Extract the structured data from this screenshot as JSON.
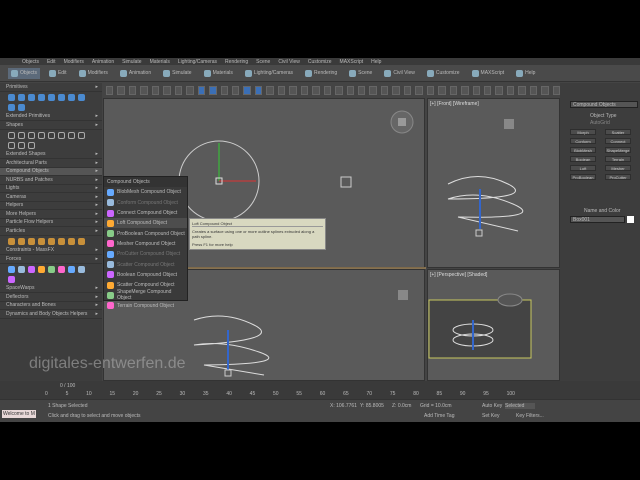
{
  "menu": [
    "Objects",
    "Edit",
    "Modifiers",
    "Animation",
    "Simulate",
    "Materials",
    "Lighting/Cameras",
    "Rendering",
    "Scene",
    "Civil View",
    "Customize",
    "MAXScript",
    "Help"
  ],
  "ribbon": [
    "Objects",
    "Edit",
    "Modifiers",
    "Animation",
    "Simulate",
    "Materials",
    "Lighting/Cameras",
    "Rendering",
    "Scene",
    "Civil View",
    "Customize",
    "MAXScript",
    "Help"
  ],
  "left_sections": [
    "Primitives",
    "Extended Primitives",
    "Shapes",
    "Extended Shapes",
    "Architectural Parts",
    "Compound Objects",
    "NURBS and Patches",
    "Lights",
    "Cameras",
    "Helpers",
    "More Helpers",
    "Particle Flow Helpers",
    "Particles",
    "Constraints - MassFX",
    "Forces",
    "SpaceWarps",
    "Deflectors",
    "Characters and Bones",
    "Dynamics and Body Objects Helpers"
  ],
  "popup": {
    "title": "Compound Objects",
    "items": [
      "BlobMesh Compound Object",
      "Conform Compound Object",
      "Connect Compound Object",
      "Loft Compound Object",
      "ProBoolean Compound Object",
      "Mesher Compound Object",
      "ProCutter Compound Object",
      "Scatter Compound Object",
      "Boolean Compound Object",
      "Scatter Compound Object",
      "ShapeMerge Compound Object",
      "Terrain Compound Object"
    ]
  },
  "tooltip": {
    "title": "Loft Compound Object",
    "desc": "Creates a surface using one or more outline splines extruded along a path spline.",
    "help": "Press F1 for more help"
  },
  "viewports": {
    "front": "[+] [Front] [Wireframe]",
    "persp": "[+] [Perspective] [Shaded]"
  },
  "right": {
    "dropdown": "Compound Objects",
    "rollout": "Object Type",
    "auto_grid": "AutoGrid",
    "buttons": [
      "Morph",
      "Scatter",
      "Conform",
      "Connect",
      "BlobMesh",
      "ShapeMerge",
      "Boolean",
      "Terrain",
      "Loft",
      "Mesher",
      "ProBoolean",
      "ProCutter"
    ],
    "name_rollout": "Name and Color",
    "name_value": "Box001"
  },
  "timeline": {
    "frame": "0 / 100",
    "ticks": [
      "0",
      "5",
      "10",
      "15",
      "20",
      "25",
      "30",
      "35",
      "40",
      "45",
      "50",
      "55",
      "60",
      "65",
      "70",
      "75",
      "80",
      "85",
      "90",
      "95",
      "100"
    ]
  },
  "status": {
    "selected": "1 Shape Selected",
    "prompt": "Click and drag to select and move objects",
    "x": "X: 106.7761",
    "y": "Y: 85.8005",
    "z": "Z: 0.0cm",
    "grid": "Grid = 10.0cm",
    "add_time_tag": "Add Time Tag",
    "auto_key": "Auto Key",
    "selected_label": "Selected",
    "set_key": "Set Key",
    "key_filters": "Key Filters...",
    "welcome": "Welcome to M"
  },
  "watermark": "digitales-entwerfen.de",
  "colors": {
    "accent": "#3b6fb6",
    "highlight": "#c8a060"
  }
}
